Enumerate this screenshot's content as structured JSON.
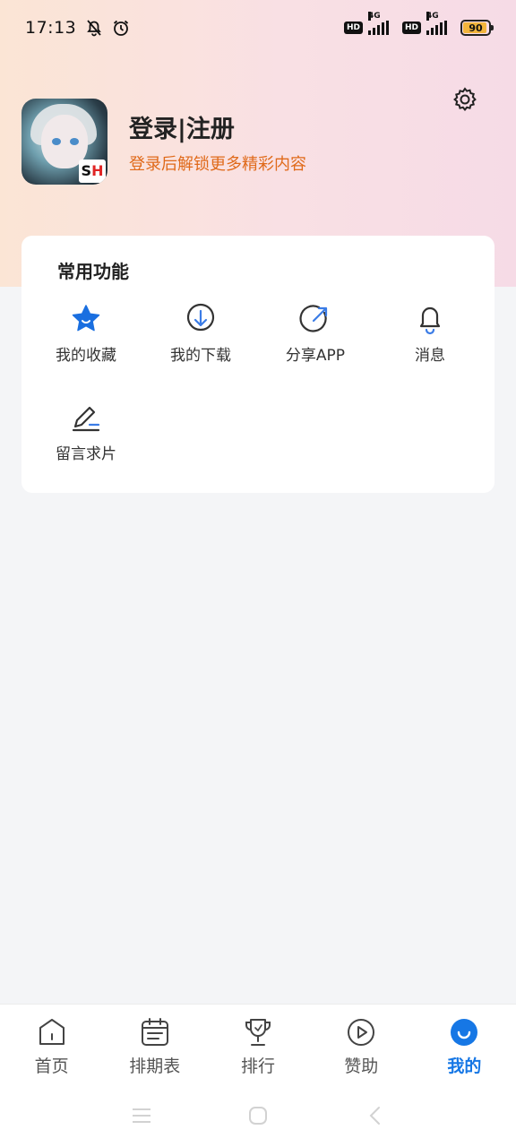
{
  "status_bar": {
    "time": "17:13",
    "battery": "90",
    "network_1": "4G",
    "network_2": "4G",
    "hd_1": "HD",
    "hd_2": "HD"
  },
  "profile": {
    "avatar_badge_s": "S",
    "avatar_badge_h": "H",
    "title": "登录|注册",
    "subtitle": "登录后解锁更多精彩内容"
  },
  "features": {
    "title": "常用功能",
    "items": [
      {
        "label": "我的收藏",
        "icon": "star-icon"
      },
      {
        "label": "我的下载",
        "icon": "download-icon"
      },
      {
        "label": "分享APP",
        "icon": "share-icon"
      },
      {
        "label": "消息",
        "icon": "bell-icon"
      },
      {
        "label": "留言求片",
        "icon": "edit-icon"
      }
    ]
  },
  "tabs": [
    {
      "label": "首页",
      "icon": "home-icon",
      "active": false
    },
    {
      "label": "排期表",
      "icon": "calendar-icon",
      "active": false
    },
    {
      "label": "排行",
      "icon": "trophy-icon",
      "active": false
    },
    {
      "label": "赞助",
      "icon": "play-circle-icon",
      "active": false
    },
    {
      "label": "我的",
      "icon": "profile-smile-icon",
      "active": true
    }
  ],
  "colors": {
    "accent": "#1677e5",
    "subtitle": "#e06a1a",
    "background": "#f4f5f7"
  }
}
